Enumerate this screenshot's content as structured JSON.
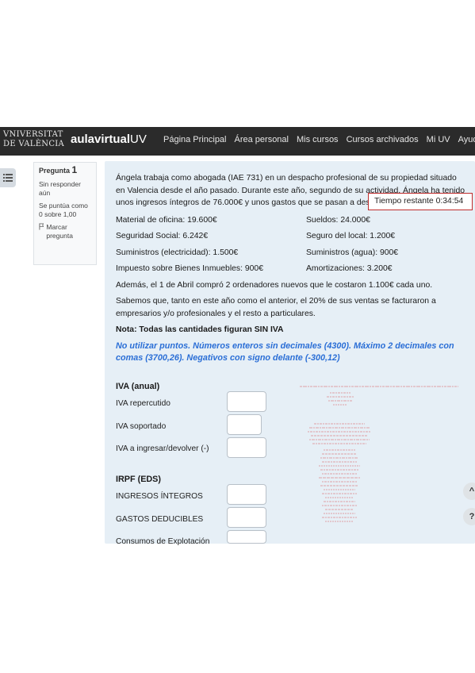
{
  "navbar": {
    "university_logo": [
      "VNIVERSITAT",
      "DE VALÈNCIA"
    ],
    "aula_logo_main": "aulavirtual",
    "aula_logo_suffix": "UV",
    "links": [
      "Página Principal",
      "Área personal",
      "Mis cursos",
      "Cursos archivados",
      "Mi UV",
      "Ayuda"
    ]
  },
  "question_info": {
    "label": "Pregunta",
    "number": "1",
    "status": "Sin responder aún",
    "score": "Se puntúa como 0 sobre 1,00",
    "flag_label": "Marcar pregunta"
  },
  "timer": {
    "label": "Tiempo restante",
    "value": "0:34:54"
  },
  "question": {
    "intro": "Ángela trabaja como abogada (IAE 731) en un despacho profesional de su propiedad situado en Valencia desde el año pasado. Durante este año, segundo de su actividad, Ángela ha tenido unos ingresos íntegros de 76.000€ y unos gastos que se pasan a desglosar en:",
    "expenses": [
      [
        "Material de oficina: 19.600€",
        "Sueldos: 24.000€"
      ],
      [
        "Seguridad Social: 6.242€",
        "Seguro del local: 1.200€"
      ],
      [
        "Suministros (electricidad): 1.500€",
        "Suministros (agua): 900€"
      ],
      [
        "Impuesto sobre Bienes Inmuebles: 900€",
        "Amortizaciones: 3.200€"
      ]
    ],
    "computers": "Además, el 1 de Abril compró 2 ordenadores nuevos que le costaron 1.100€ cada uno.",
    "sales": "Sabemos que, tanto en este año como el anterior, el 20% de sus ventas se facturaron a empresarios y/o profesionales y el resto a particulares.",
    "note": "Nota: Todas las cantidades figuran SIN IVA",
    "format_hint": "No utilizar puntos. Números enteros sin decimales (4300). Máximo 2 decimales con comas (3700,26). Negativos con signo delante (-300,12)"
  },
  "form": {
    "iva_title": "IVA (anual)",
    "iva_rows": [
      "IVA repercutido",
      "IVA soportado",
      "IVA a ingresar/devolver (-)"
    ],
    "irpf_title": "IRPF (EDS)",
    "irpf_rows": [
      "INGRESOS ÍNTEGROS",
      "GASTOS DEDUCIBLES",
      "Consumos de Explotación"
    ]
  },
  "floating_buttons": [
    "^",
    "?"
  ],
  "colors": {
    "navbar_bg": "#2b2b2b",
    "question_bg": "#e6eff6",
    "hint_blue": "#2a6ed6",
    "timer_border": "#c02d2d",
    "annotation_red": "#d23b3b"
  }
}
